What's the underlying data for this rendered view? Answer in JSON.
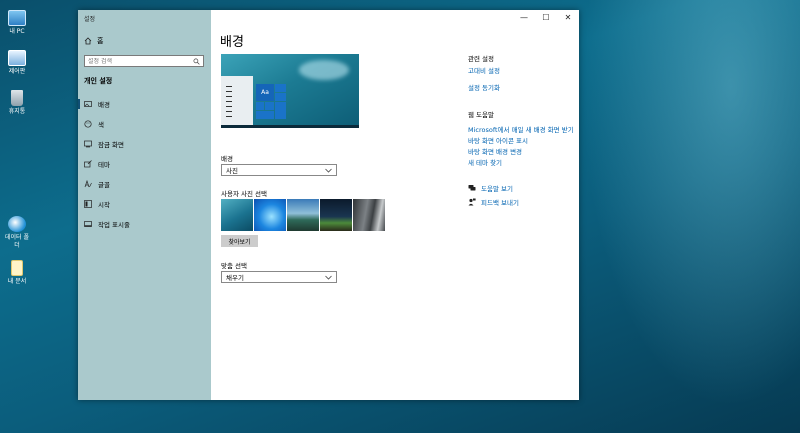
{
  "desktop": {
    "icons": [
      {
        "label": "내 PC",
        "icon": "computer-icon"
      },
      {
        "label": "제어판",
        "icon": "control-panel-icon"
      },
      {
        "label": "휴지통",
        "icon": "recycle-bin-icon"
      },
      {
        "label": "데이터 폴더",
        "icon": "folder-icon"
      },
      {
        "label": "내 문서",
        "icon": "document-icon"
      }
    ]
  },
  "window": {
    "title": "설정",
    "controls": {
      "minimize": "—",
      "maximize": "☐",
      "close": "✕"
    }
  },
  "sidebar": {
    "home": "홈",
    "search_placeholder": "설정 검색",
    "section": "개인 설정",
    "items": [
      {
        "label": "배경",
        "icon": "picture-icon",
        "active": true
      },
      {
        "label": "색",
        "icon": "palette-icon",
        "active": false
      },
      {
        "label": "잠금 화면",
        "icon": "lock-screen-icon",
        "active": false
      },
      {
        "label": "테마",
        "icon": "brush-icon",
        "active": false
      },
      {
        "label": "글꼴",
        "icon": "font-icon",
        "active": false
      },
      {
        "label": "시작",
        "icon": "start-icon",
        "active": false
      },
      {
        "label": "작업 표시줄",
        "icon": "taskbar-icon",
        "active": false
      }
    ]
  },
  "main": {
    "title": "배경",
    "preview_tile_text": "Aa",
    "background_label": "배경",
    "background_value": "사진",
    "choose_photo_label": "사용자 사진 선택",
    "browse_button": "찾아보기",
    "fit_label": "맞춤 선택",
    "fit_value": "채우기"
  },
  "related": {
    "heading": "관련 설정",
    "links": [
      "고대비 설정",
      "설정 동기화"
    ]
  },
  "web_help": {
    "heading": "웹 도움말",
    "links": [
      "Microsoft에서 매일 새 배경 화면 받기",
      "바탕 화면 아이콘 표시",
      "바탕 화면 배경 변경",
      "새 테마 찾기"
    ]
  },
  "support": {
    "get_help": "도움말 보기",
    "feedback": "피드백 보내기"
  },
  "colors": {
    "accent": "#0063b1",
    "sidebar_bg": "#aac9cc"
  }
}
